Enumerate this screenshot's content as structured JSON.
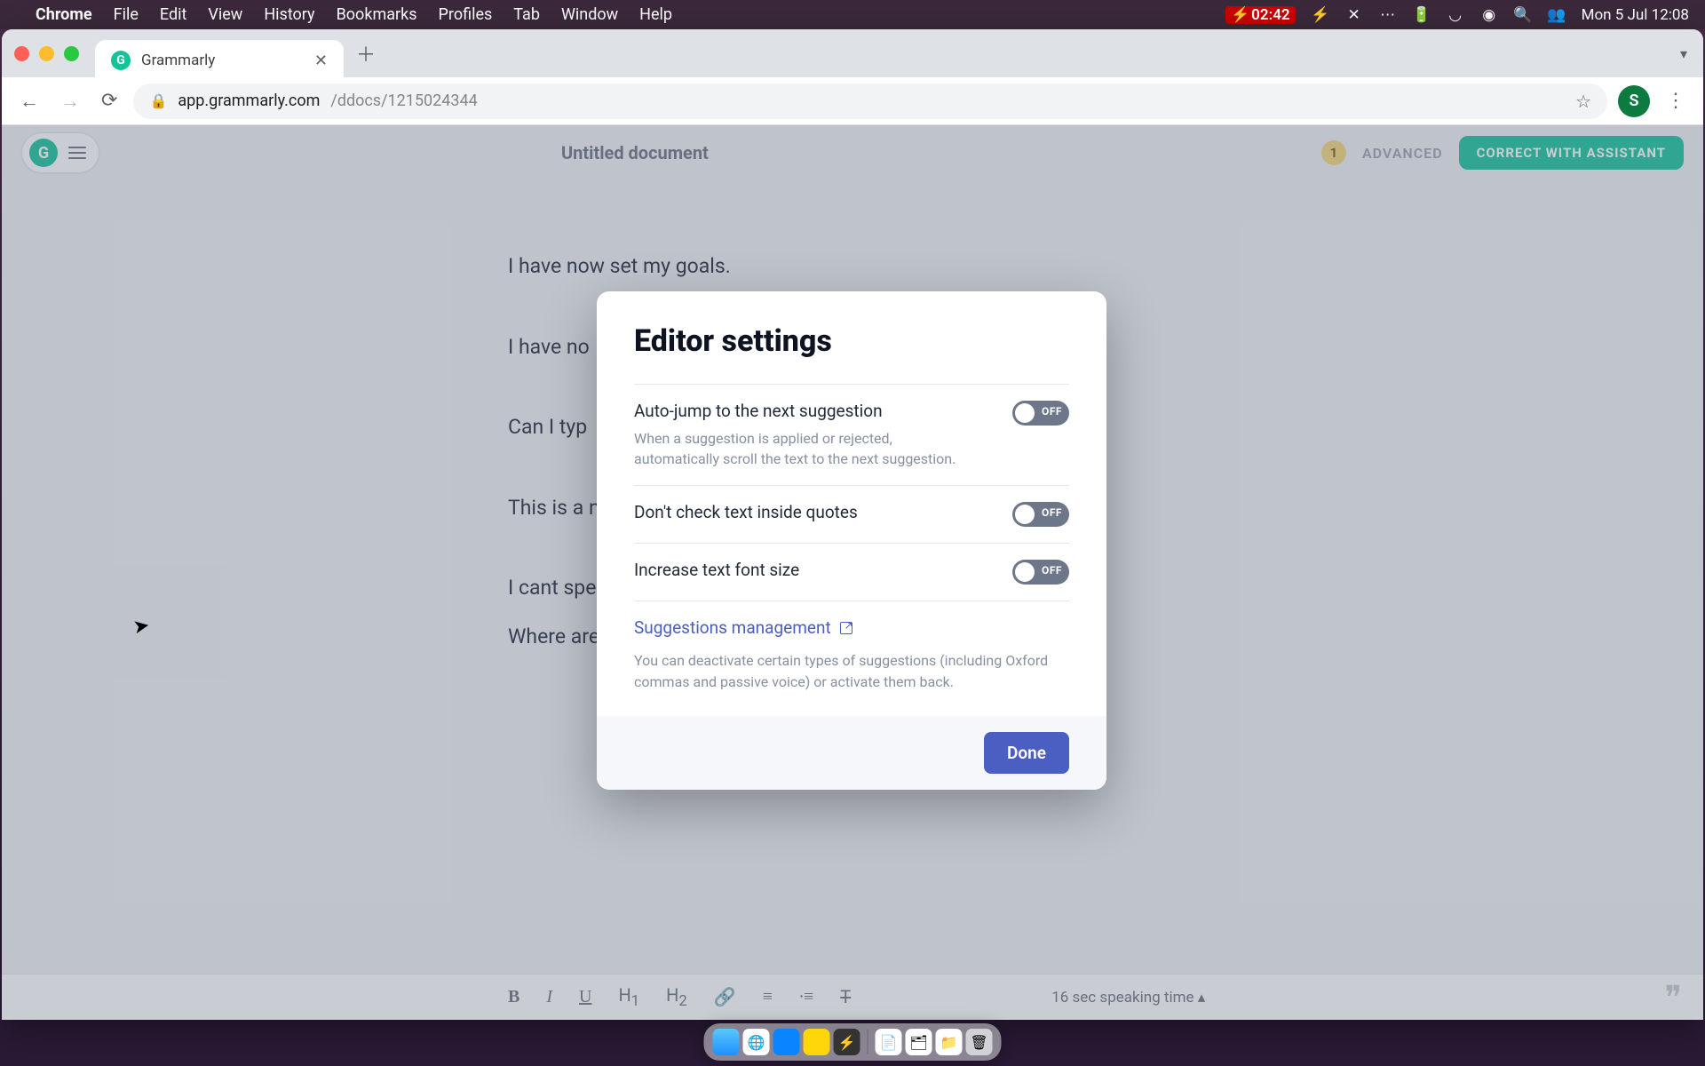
{
  "menubar": {
    "app": "Chrome",
    "items": [
      "File",
      "Edit",
      "View",
      "History",
      "Bookmarks",
      "Profiles",
      "Tab",
      "Window",
      "Help"
    ],
    "timer": "02:42",
    "datetime": "Mon 5 Jul  12:08"
  },
  "browser": {
    "tab_title": "Grammarly",
    "url_host": "app.grammarly.com",
    "url_path": "/ddocs/1215024344",
    "profile_initial": "S"
  },
  "editor": {
    "doc_title": "Untitled document",
    "suggestion_count": "1",
    "mode_label": "ADVANCED",
    "assist_button": "CORRECT WITH ASSISTANT",
    "lines": [
      "I have now set my goals.",
      "I have no",
      "Can I typ",
      "This is a n",
      "I cant spe",
      "Where are"
    ],
    "speaking_time": "16 sec speaking time"
  },
  "modal": {
    "title": "Editor settings",
    "settings": [
      {
        "label": "Auto-jump to the next suggestion",
        "desc": "When a suggestion is applied or rejected, automatically scroll the text to the next suggestion.",
        "state": "OFF"
      },
      {
        "label": "Don't check text inside quotes",
        "desc": "",
        "state": "OFF"
      },
      {
        "label": "Increase text font size",
        "desc": "",
        "state": "OFF"
      }
    ],
    "link_label": "Suggestions management",
    "link_desc": "You can deactivate certain types of suggestions (including Oxford commas and passive voice) or activate them back.",
    "done": "Done"
  },
  "toolbar": {
    "bold": "B",
    "italic": "I",
    "underline": "U",
    "h1": "H",
    "h2": "H",
    "h1sub": "1",
    "h2sub": "2"
  }
}
